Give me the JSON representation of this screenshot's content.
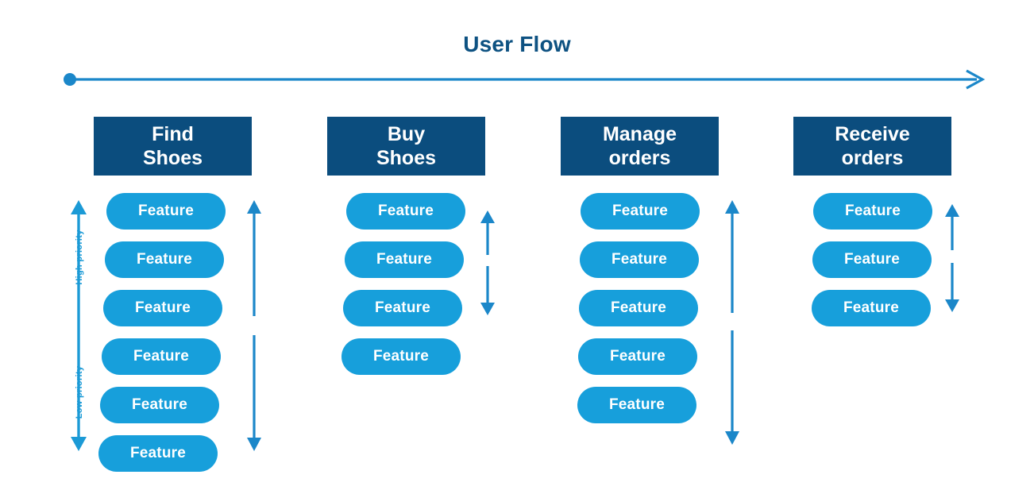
{
  "page": {
    "title": "User Flow",
    "title_color": "#0e5282",
    "background": "#ffffff",
    "accent_light": "#179fdb",
    "accent_dark": "#0b4d7e",
    "arrow_color": "#1b87c9"
  },
  "flow_arrow": {
    "direction": "left-to-right",
    "start_marker": "dot",
    "end_marker": "arrowhead"
  },
  "priority_axis": {
    "high_label": "High priority",
    "low_label": "Low priority",
    "direction": "double-headed-vertical",
    "color": "#1b9ad6"
  },
  "columns": [
    {
      "id": "find-shoes",
      "header": "Find\nShoes",
      "feature_label": "Feature",
      "feature_count": 6,
      "features": [
        "Feature",
        "Feature",
        "Feature",
        "Feature",
        "Feature",
        "Feature"
      ],
      "arrow": {
        "type": "double-headed-vertical",
        "has_gap": true
      }
    },
    {
      "id": "buy-shoes",
      "header": "Buy\nShoes",
      "feature_label": "Feature",
      "feature_count": 4,
      "features": [
        "Feature",
        "Feature",
        "Feature",
        "Feature"
      ],
      "arrow": {
        "type": "double-headed-vertical",
        "has_gap": true
      }
    },
    {
      "id": "manage-orders",
      "header": "Manage\norders",
      "feature_label": "Feature",
      "feature_count": 5,
      "features": [
        "Feature",
        "Feature",
        "Feature",
        "Feature",
        "Feature"
      ],
      "arrow": {
        "type": "double-headed-vertical",
        "has_gap": true
      }
    },
    {
      "id": "receive-orders",
      "header": "Receive\norders",
      "feature_label": "Feature",
      "feature_count": 3,
      "features": [
        "Feature",
        "Feature",
        "Feature"
      ],
      "arrow": {
        "type": "double-headed-vertical",
        "has_gap": true
      }
    }
  ]
}
